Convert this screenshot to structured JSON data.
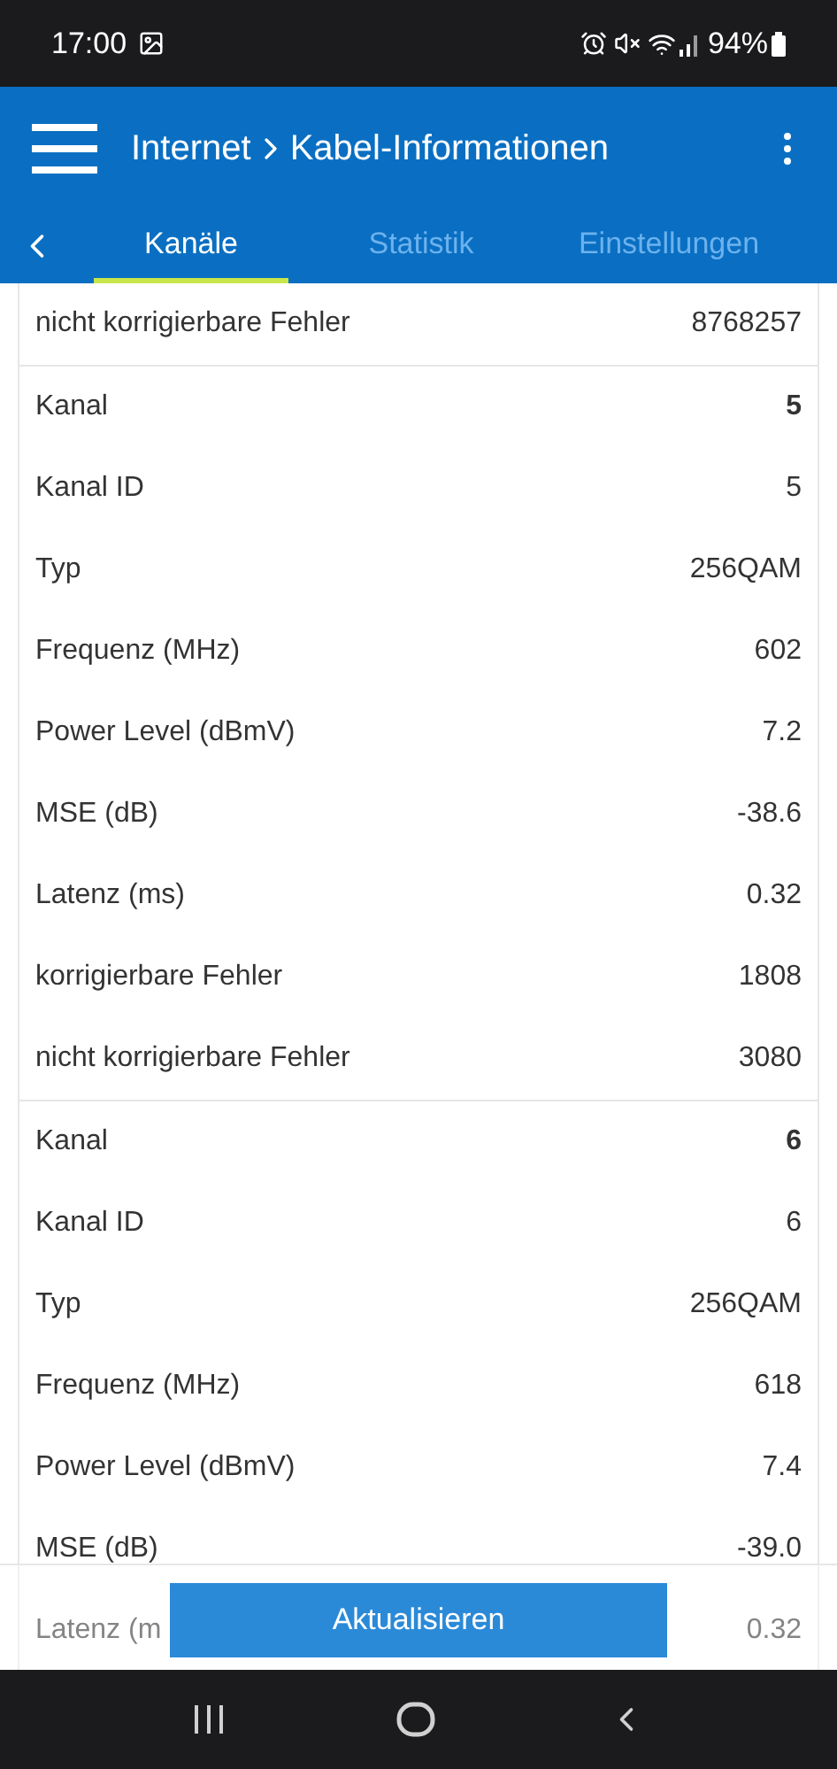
{
  "status_bar": {
    "time": "17:00",
    "battery": "94%"
  },
  "header": {
    "breadcrumb": "Internet",
    "title": "Kabel-Informationen"
  },
  "tabs": [
    {
      "label": "Kanäle",
      "selected": true
    },
    {
      "label": "Statistik",
      "selected": false
    },
    {
      "label": "Einstellungen",
      "selected": false
    }
  ],
  "groups": [
    {
      "rows": [
        {
          "kind": "field",
          "label": "nicht korrigierbare Fehler",
          "value": "8768257"
        }
      ]
    },
    {
      "rows": [
        {
          "kind": "channel",
          "label": "Kanal",
          "value": "5"
        },
        {
          "kind": "field",
          "label": "Kanal ID",
          "value": "5"
        },
        {
          "kind": "field",
          "label": "Typ",
          "value": "256QAM"
        },
        {
          "kind": "field",
          "label": "Frequenz (MHz)",
          "value": "602"
        },
        {
          "kind": "field",
          "label": "Power Level (dBmV)",
          "value": "7.2"
        },
        {
          "kind": "field",
          "label": "MSE (dB)",
          "value": "-38.6"
        },
        {
          "kind": "field",
          "label": "Latenz (ms)",
          "value": "0.32"
        },
        {
          "kind": "field",
          "label": "korrigierbare Fehler",
          "value": "1808"
        },
        {
          "kind": "field",
          "label": "nicht korrigierbare Fehler",
          "value": "3080"
        }
      ]
    },
    {
      "rows": [
        {
          "kind": "channel",
          "label": "Kanal",
          "value": "6"
        },
        {
          "kind": "field",
          "label": "Kanal ID",
          "value": "6"
        },
        {
          "kind": "field",
          "label": "Typ",
          "value": "256QAM"
        },
        {
          "kind": "field",
          "label": "Frequenz (MHz)",
          "value": "618"
        },
        {
          "kind": "field",
          "label": "Power Level (dBmV)",
          "value": "7.4"
        },
        {
          "kind": "field",
          "label": "MSE (dB)",
          "value": "-39.0"
        },
        {
          "kind": "field",
          "label": "Latenz (m",
          "value": "0.32"
        }
      ]
    }
  ],
  "refresh_button": "Aktualisieren"
}
